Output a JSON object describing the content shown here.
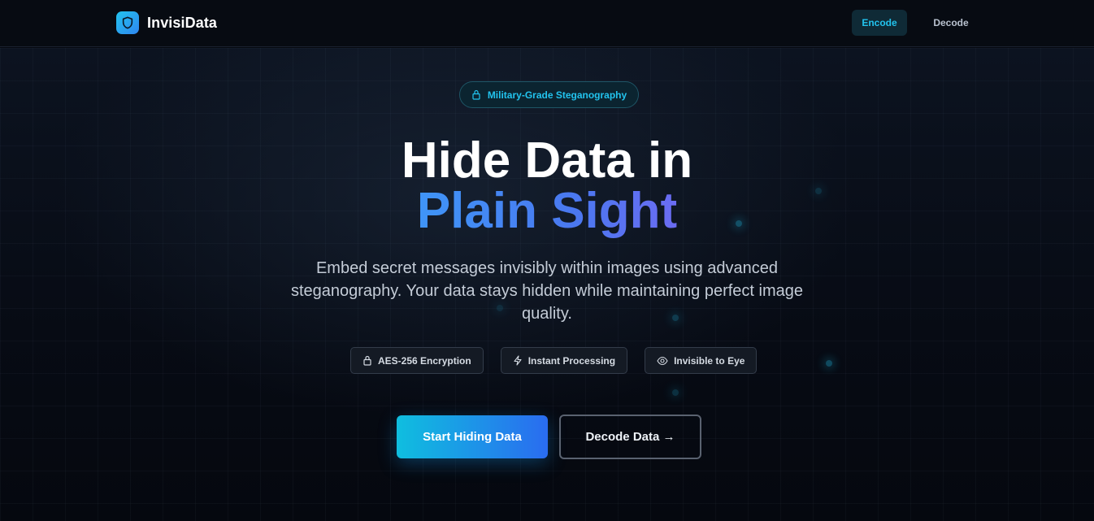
{
  "brand": {
    "name": "InvisiData",
    "logo_icon": "shield-icon"
  },
  "nav": {
    "items": [
      {
        "label": "Encode",
        "active": true
      },
      {
        "label": "Decode",
        "active": false
      }
    ]
  },
  "hero": {
    "badge": {
      "label": "Military-Grade Steganography",
      "icon": "lock-icon"
    },
    "title_line1": "Hide Data in",
    "title_line2": "Plain Sight",
    "subtitle": "Embed secret messages invisibly within images using advanced steganography. Your data stays hidden while maintaining perfect image quality.",
    "features": [
      {
        "label": "AES-256 Encryption",
        "icon": "lock-icon"
      },
      {
        "label": "Instant Processing",
        "icon": "lightning-icon"
      },
      {
        "label": "Invisible to Eye",
        "icon": "eye-icon"
      }
    ],
    "primary_button": "Start Hiding Data",
    "secondary_button": "Decode Data →"
  },
  "colors": {
    "accent": "#22c3ee",
    "primary_gradient_start": "#0fbedf",
    "primary_gradient_end": "#2a6cf0",
    "title_gradient": "#3f95f7",
    "background": "#05080f"
  }
}
